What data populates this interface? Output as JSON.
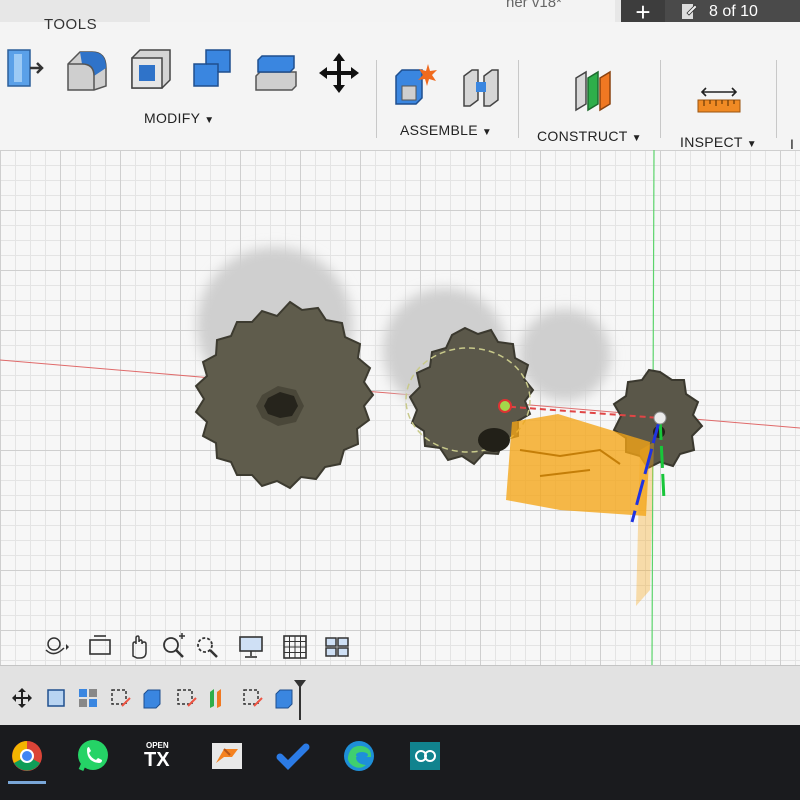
{
  "tabs": {
    "document_title": "ner v18*",
    "close_glyph": "✕",
    "add_glyph": "+",
    "page_counter": "8 of 10"
  },
  "toolbar": {
    "section_title": "TOOLS",
    "groups": [
      {
        "label": "MODIFY",
        "tools": [
          "press-pull-icon",
          "fillet-icon",
          "shell-icon",
          "combine-icon",
          "replace-face-icon",
          "move-icon"
        ]
      },
      {
        "label": "ASSEMBLE",
        "tools": [
          "new-component-icon",
          "joint-icon"
        ]
      },
      {
        "label": "CONSTRUCT",
        "tools": [
          "offset-plane-icon"
        ]
      },
      {
        "label": "INSPECT",
        "tools": [
          "measure-icon"
        ]
      },
      {
        "label": "I",
        "tools": []
      }
    ]
  },
  "canvas": {
    "model": "three meshed spur gears with selected component origin",
    "colors": {
      "gear": "#5f5c4c",
      "selection": "#f2a51f",
      "x_axis": "#e05050",
      "y_axis": "#2bb84a",
      "z_axis": "#2a3ed8"
    }
  },
  "navigation_bar": {
    "tools": [
      "orbit-icon",
      "look-at-icon",
      "pan-icon",
      "zoom-icon",
      "fit-icon",
      "display-settings-icon",
      "grid-settings-icon",
      "viewports-icon"
    ]
  },
  "timeline": {
    "items": [
      "move-icon",
      "sketch-icon",
      "component-icon",
      "sketch-icon",
      "extrude-icon",
      "sketch-icon",
      "joint-icon",
      "sketch-icon",
      "extrude-icon"
    ]
  },
  "taskbar": {
    "apps": [
      {
        "name": "Chrome",
        "icon": "chrome-icon"
      },
      {
        "name": "WhatsApp",
        "icon": "whatsapp-icon"
      },
      {
        "name": "OpenTX",
        "icon": "opentx-icon",
        "label_top": "OPEN",
        "label_main": "TX"
      },
      {
        "name": "Fusion 360",
        "icon": "fusion-icon"
      },
      {
        "name": "To Do",
        "icon": "todo-icon"
      },
      {
        "name": "Edge",
        "icon": "edge-icon"
      },
      {
        "name": "Arduino",
        "icon": "arduino-icon"
      }
    ]
  }
}
